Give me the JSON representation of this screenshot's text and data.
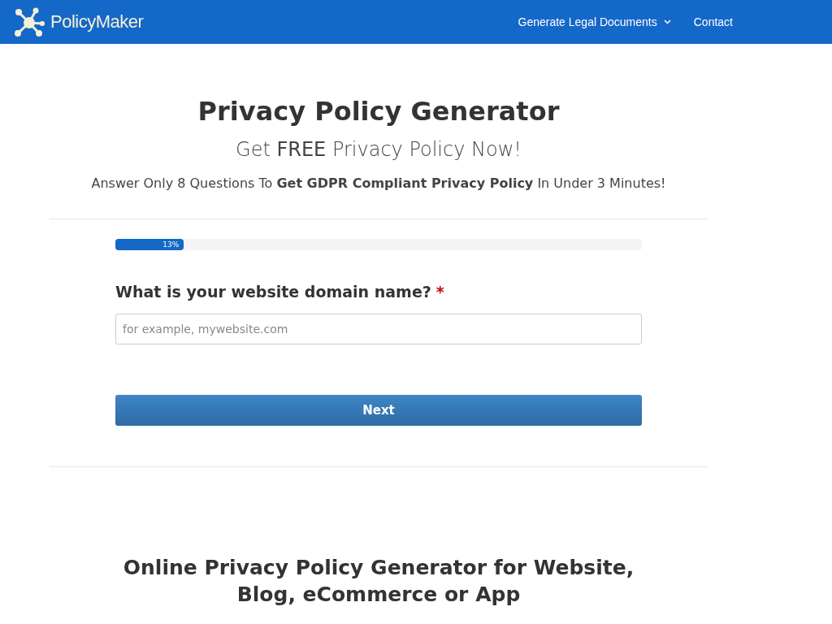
{
  "header": {
    "logo": "PolicyMaker",
    "nav": [
      {
        "label": "Generate Legal Documents",
        "dropdown": true
      },
      {
        "label": "Contact",
        "dropdown": false
      }
    ]
  },
  "hero": {
    "title": "Privacy Policy Generator",
    "subtitle": "Get **FREE** Privacy Policy Now!",
    "tagline": "Answer Only 8 Questions To **Get GDPR Compliant Privacy Policy** In Under 3 Minutes!"
  },
  "form": {
    "progress": {
      "level": 0.13,
      "label": "13%"
    },
    "question": "What is your website domain name?",
    "required_mark": "*",
    "field": {
      "placeholder": "for example, mywebsite.com"
    },
    "button": "Next"
  },
  "section": {
    "heading": "Online Privacy Policy Generator for Website, Blog, eCommerce or App"
  }
}
